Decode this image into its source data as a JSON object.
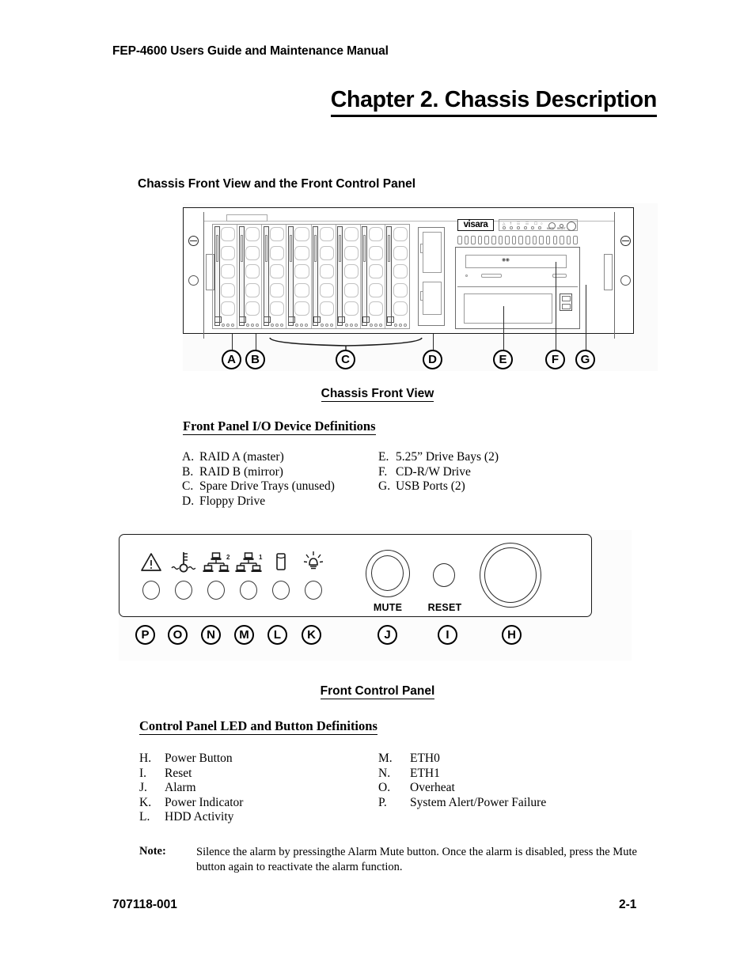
{
  "header": {
    "running_title": "FEP-4600 Users Guide and Maintenance Manual"
  },
  "chapter": {
    "title": "Chapter 2. Chassis Description"
  },
  "section": {
    "heading": "Chassis Front View and the Front Control Panel"
  },
  "figure1": {
    "caption": "Chassis Front View",
    "brand_logo": "visara",
    "callouts": [
      "A",
      "B",
      "C",
      "D",
      "E",
      "F",
      "G"
    ],
    "mini_panel": {
      "mute_label": "MUTE",
      "reset_label": "RESET"
    }
  },
  "front_panel_definitions": {
    "title": "Front Panel I/O Device Definitions",
    "left_column": [
      {
        "key": "A.",
        "value": "RAID A (master)"
      },
      {
        "key": "B.",
        "value": "RAID B (mirror)"
      },
      {
        "key": "C.",
        "value": "Spare Drive Trays (unused)"
      },
      {
        "key": "D.",
        "value": "Floppy Drive"
      }
    ],
    "right_column": [
      {
        "key": "E.",
        "value": "5.25” Drive Bays (2)"
      },
      {
        "key": "F.",
        "value": "CD-R/W Drive"
      },
      {
        "key": "G.",
        "value": "USB Ports (2)"
      }
    ]
  },
  "figure2": {
    "caption": "Front Control Panel",
    "callouts": [
      "P",
      "O",
      "N",
      "M",
      "L",
      "K",
      "J",
      "I",
      "H"
    ],
    "led_icons": [
      {
        "name": "warning-triangle-icon",
        "meaning": "System Alert/Power Failure",
        "callout": "P"
      },
      {
        "name": "thermometer-icon",
        "meaning": "Overheat",
        "callout": "O"
      },
      {
        "name": "network-eth1-icon",
        "meaning": "ETH1",
        "callout": "N",
        "superscript": "2"
      },
      {
        "name": "network-eth0-icon",
        "meaning": "ETH0",
        "callout": "M",
        "superscript": "1"
      },
      {
        "name": "hdd-icon",
        "meaning": "HDD Activity",
        "callout": "L"
      },
      {
        "name": "power-lamp-icon",
        "meaning": "Power Indicator",
        "callout": "K"
      }
    ],
    "buttons": [
      {
        "name": "alarm-mute-button",
        "label": "MUTE",
        "callout": "J"
      },
      {
        "name": "reset-button",
        "label": "RESET",
        "callout": "I"
      },
      {
        "name": "power-button",
        "label": "",
        "callout": "H"
      }
    ]
  },
  "control_panel_definitions": {
    "title": "Control Panel LED and Button Definitions",
    "left_column": [
      {
        "key": "H.",
        "value": "Power Button"
      },
      {
        "key": "I.",
        "value": "Reset"
      },
      {
        "key": "J.",
        "value": "Alarm"
      },
      {
        "key": "K.",
        "value": "Power Indicator"
      },
      {
        "key": "L.",
        "value": "HDD Activity"
      }
    ],
    "right_column": [
      {
        "key": "M.",
        "value": "ETH0"
      },
      {
        "key": "N.",
        "value": "ETH1"
      },
      {
        "key": "O.",
        "value": "Overheat"
      },
      {
        "key": "P.",
        "value": "System Alert/Power Failure"
      }
    ]
  },
  "note": {
    "label": "Note:",
    "text": "Silence the alarm by pressingthe Alarm Mute button. Once the alarm is disabled, press the Mute button again to reactivate the alarm function."
  },
  "footer": {
    "document_number": "707118-001",
    "page_number": "2-1"
  }
}
